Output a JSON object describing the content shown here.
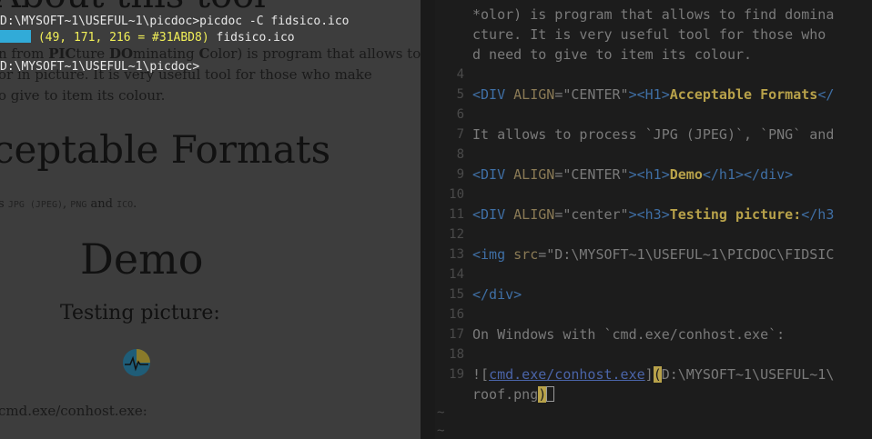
{
  "preview": {
    "heading1": "About this tool",
    "para1_prefix": "n from ",
    "para1_b1": "PIC",
    "para1_mid1": "ture ",
    "para1_b2": "DO",
    "para1_mid2": "minating ",
    "para1_b3": "C",
    "para1_suffix": "olor) is program that allows to",
    "para2": "or in picture. It is very useful tool for those who make",
    "para3": "o give to item its colour.",
    "heading2": "ceptable Formats",
    "allows_prefix": "s ",
    "allows_f1": "JPG (JPEG)",
    "allows_sep1": ", ",
    "allows_f2": "PNG",
    "allows_sep2": " and ",
    "allows_f3": "ICO",
    "allows_end": ".",
    "demo": "Demo",
    "testing": "Testing picture:",
    "caption": "cmd.exe/conhost.exe:"
  },
  "terminal": {
    "line1": "D:\\MYSOFT~1\\USEFUL~1\\picdoc>picdoc -C fidsico.ico",
    "rgb": " (49, 171, 216 = #31ABD8)",
    "file": " fidsico.ico",
    "line3": "D:\\MYSOFT~1\\USEFUL~1\\picdoc>",
    "swatch_color": "#31ABD8"
  },
  "editor": {
    "line_numbers": [
      "4",
      "5",
      "6",
      "7",
      "8",
      "9",
      "10",
      "11",
      "12",
      "13",
      "14",
      "15",
      "16",
      "17",
      "18",
      "19"
    ],
    "wrap1": "*olor) is program that allows to find domina",
    "wrap2": "cture. It is very useful tool for those who",
    "wrap3": "d need to give to item its colour.",
    "l5_tag1": "<DIV ",
    "l5_attr": "ALIGN",
    "l5_eq": "=",
    "l5_str": "\"CENTER\"",
    "l5_tag2": "><H1>",
    "l5_bold": "Acceptable Formats",
    "l5_tag3": "</",
    "l7": "It allows to process `JPG (JPEG)`, `PNG` and",
    "l9_tag1": "<DIV ",
    "l9_attr": "ALIGN",
    "l9_eq": "=",
    "l9_str": "\"CENTER\"",
    "l9_tag2": "><h1>",
    "l9_bold": "Demo",
    "l9_tag3": "</h1></div>",
    "l11_tag1": "<DIV ",
    "l11_attr": "ALIGN",
    "l11_eq": "=",
    "l11_str": "\"center\"",
    "l11_tag2": "><h3>",
    "l11_bold": "Testing picture:",
    "l11_tag3": "</h3",
    "l13_tag1": "<img ",
    "l13_attr": "src",
    "l13_eq": "=",
    "l13_str": "\"D:\\MYSOFT~1\\USEFUL~1\\PICDOC\\FIDSIC",
    "l15": "</div>",
    "l17": "On Windows with `cmd.exe/conhost.exe`:",
    "l19_pre": "![",
    "l19_link": "cmd.exe/conhost.exe",
    "l19_mid": "]",
    "l19_paren": "(",
    "l19_rest": "D:\\MYSOFT~1\\USEFUL~1\\",
    "l19b_text": "roof.png",
    "l19b_paren": ")",
    "tilde": "~"
  }
}
